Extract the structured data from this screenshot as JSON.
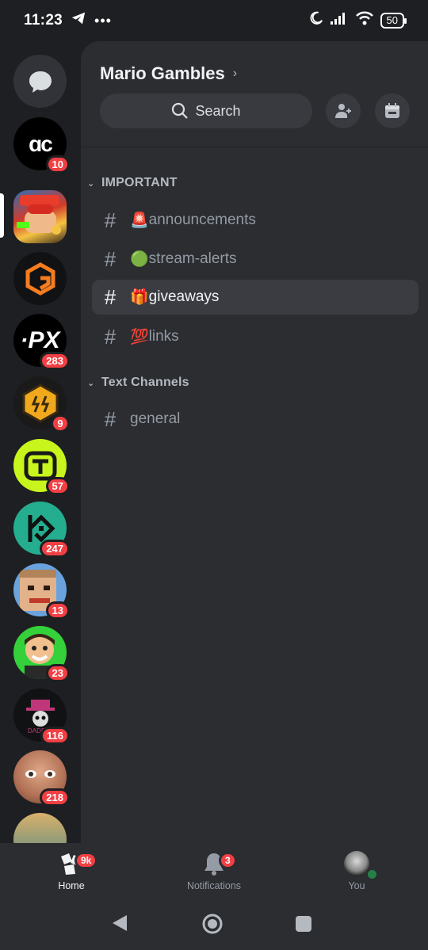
{
  "status": {
    "time": "11:23",
    "battery": "50"
  },
  "server": {
    "title": "Mario Gambles"
  },
  "search": {
    "label": "Search"
  },
  "guilds": [
    {
      "name": "home-dm",
      "badge": ""
    },
    {
      "name": "AC",
      "badge": "10"
    },
    {
      "name": "Mario Gambles",
      "badge": ""
    },
    {
      "name": "G",
      "badge": ""
    },
    {
      "name": "PX",
      "badge": "283"
    },
    {
      "name": "Emblem",
      "badge": "9"
    },
    {
      "name": "Gamdom",
      "badge": "57"
    },
    {
      "name": "Kucoin",
      "badge": "247"
    },
    {
      "name": "Pixel",
      "badge": "13"
    },
    {
      "name": "Cartoon",
      "badge": "23"
    },
    {
      "name": "Daddy",
      "badge": "116"
    },
    {
      "name": "Face",
      "badge": "218"
    },
    {
      "name": "Beach",
      "badge": ""
    }
  ],
  "categories": [
    {
      "label": "IMPORTANT"
    },
    {
      "label": "Text Channels"
    }
  ],
  "channels": [
    {
      "emoji": "🚨",
      "name": "announcements"
    },
    {
      "emoji": "🟢",
      "name": "stream-alerts"
    },
    {
      "emoji": "🎁",
      "name": "giveaways"
    },
    {
      "emoji": "💯",
      "name": "links"
    },
    {
      "emoji": "",
      "name": "general"
    }
  ],
  "nav": {
    "home": {
      "label": "Home",
      "badge": "9k"
    },
    "notifications": {
      "label": "Notifications",
      "badge": "3"
    },
    "you": {
      "label": "You"
    }
  },
  "colors": {
    "accent_red": "#f23f43",
    "panel": "#2b2d31",
    "rail": "#1e1f22"
  }
}
